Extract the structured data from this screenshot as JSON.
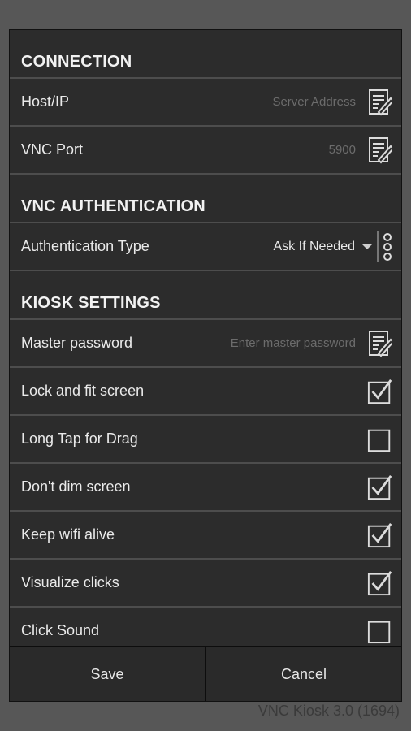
{
  "sections": {
    "connection": {
      "title": "CONNECTION",
      "host": {
        "label": "Host/IP",
        "placeholder": "Server Address"
      },
      "port": {
        "label": "VNC Port",
        "placeholder": "5900"
      }
    },
    "auth": {
      "title": "VNC AUTHENTICATION",
      "type": {
        "label": "Authentication Type",
        "value": "Ask If Needed"
      }
    },
    "kiosk": {
      "title": "KIOSK SETTINGS",
      "master": {
        "label": "Master password",
        "placeholder": "Enter master password"
      },
      "lock_fit": {
        "label": "Lock and fit screen",
        "checked": true
      },
      "long_tap": {
        "label": "Long Tap for Drag",
        "checked": false
      },
      "dont_dim": {
        "label": "Don't dim screen",
        "checked": true
      },
      "wifi": {
        "label": "Keep wifi alive",
        "checked": true
      },
      "visualize": {
        "label": "Visualize clicks",
        "checked": true
      },
      "click_sound": {
        "label": "Click Sound",
        "checked": false
      }
    }
  },
  "footer": {
    "save": "Save",
    "cancel": "Cancel"
  },
  "version": "VNC Kiosk 3.0 (1694)",
  "icons": {
    "edit": "edit-icon",
    "checkbox": "checkbox-icon",
    "options": "options-icon"
  }
}
